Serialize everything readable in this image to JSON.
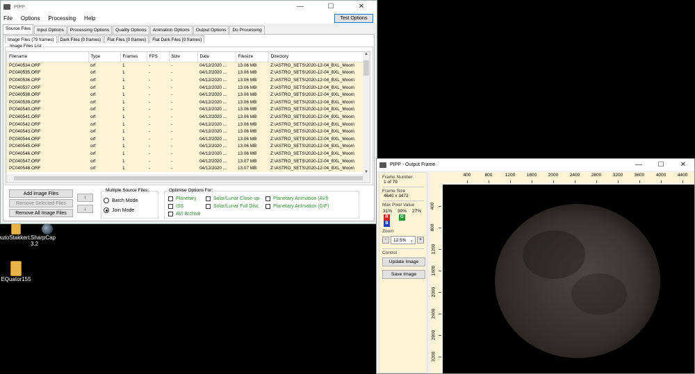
{
  "desktop": {
    "icons": [
      {
        "label": "AutoStakkert..."
      },
      {
        "label": "SharpCap 3.2"
      },
      {
        "label": "EQuator155"
      }
    ]
  },
  "main_window": {
    "title": "PIPP",
    "menu": [
      "File",
      "Options",
      "Processing",
      "Help"
    ],
    "test_options": "Test Options",
    "tabs": [
      "Source Files",
      "Input Options",
      "Processing Options",
      "Quality Options",
      "Animation Options",
      "Output Options",
      "Do Processing"
    ],
    "subtabs": [
      "Image Files (79 frames)",
      "Dark Files (0 frames)",
      "Flat Files (0 frames)",
      "Flat Dark Files (0 frames)"
    ],
    "list_group_label": "Image Files List",
    "columns": [
      "Filename",
      "Type",
      "Frames",
      "FPS",
      "Size",
      "Date",
      "Filesize",
      "Directory"
    ],
    "rows": [
      [
        "PC040534.ORF",
        "orf",
        "1",
        "-",
        "-",
        "04/12/2020 ...",
        "13.06 MB",
        "Z:\\ASTRO_SETS\\2020-12-04_BXL_Moon\\"
      ],
      [
        "PC040535.ORF",
        "orf",
        "1",
        "-",
        "-",
        "04/12/2020 ...",
        "13.06 MB",
        "Z:\\ASTRO_SETS\\2020-12-04_BXL_Moon\\"
      ],
      [
        "PC040536.ORF",
        "orf",
        "1",
        "-",
        "-",
        "04/12/2020 ...",
        "13.06 MB",
        "Z:\\ASTRO_SETS\\2020-12-04_BXL_Moon\\"
      ],
      [
        "PC040537.ORF",
        "orf",
        "1",
        "-",
        "-",
        "04/12/2020 ...",
        "13.06 MB",
        "Z:\\ASTRO_SETS\\2020-12-04_BXL_Moon\\"
      ],
      [
        "PC040538.ORF",
        "orf",
        "1",
        "-",
        "-",
        "04/12/2020 ...",
        "13.06 MB",
        "Z:\\ASTRO_SETS\\2020-12-04_BXL_Moon\\"
      ],
      [
        "PC040539.ORF",
        "orf",
        "1",
        "-",
        "-",
        "04/12/2020 ...",
        "13.06 MB",
        "Z:\\ASTRO_SETS\\2020-12-04_BXL_Moon\\"
      ],
      [
        "PC040540.ORF",
        "orf",
        "1",
        "-",
        "-",
        "04/12/2020 ...",
        "13.06 MB",
        "Z:\\ASTRO_SETS\\2020-12-04_BXL_Moon\\"
      ],
      [
        "PC040541.ORF",
        "orf",
        "1",
        "-",
        "-",
        "04/12/2020 ...",
        "13.06 MB",
        "Z:\\ASTRO_SETS\\2020-12-04_BXL_Moon\\"
      ],
      [
        "PC040542.ORF",
        "orf",
        "1",
        "-",
        "-",
        "04/12/2020 ...",
        "13.06 MB",
        "Z:\\ASTRO_SETS\\2020-12-04_BXL_Moon\\"
      ],
      [
        "PC040543.ORF",
        "orf",
        "1",
        "-",
        "-",
        "04/12/2020 ...",
        "13.06 MB",
        "Z:\\ASTRO_SETS\\2020-12-04_BXL_Moon\\"
      ],
      [
        "PC040544.ORF",
        "orf",
        "1",
        "-",
        "-",
        "04/12/2020 ...",
        "13.06 MB",
        "Z:\\ASTRO_SETS\\2020-12-04_BXL_Moon\\"
      ],
      [
        "PC040545.ORF",
        "orf",
        "1",
        "-",
        "-",
        "04/12/2020 ...",
        "13.06 MB",
        "Z:\\ASTRO_SETS\\2020-12-04_BXL_Moon\\"
      ],
      [
        "PC040546.ORF",
        "orf",
        "1",
        "-",
        "-",
        "04/12/2020 ...",
        "13.06 MB",
        "Z:\\ASTRO_SETS\\2020-12-04_BXL_Moon\\"
      ],
      [
        "PC040547.ORF",
        "orf",
        "1",
        "-",
        "-",
        "04/12/2020 ...",
        "13.07 MB",
        "Z:\\ASTRO_SETS\\2020-12-04_BXL_Moon\\"
      ],
      [
        "PC040548.ORF",
        "orf",
        "1",
        "-",
        "-",
        "04/12/2020 ...",
        "13.07 MB",
        "Z:\\ASTRO_SETS\\2020-12-04_BXL_Moon\\"
      ]
    ],
    "buttons": {
      "add": "Add Image Files",
      "remove_selected": "Remove Selected Files",
      "remove_all": "Remove All Image Files",
      "up": "↑",
      "down": "↓"
    },
    "multiple_source": {
      "label": "Multiple Source Files:",
      "batch": "Batch Mode",
      "join": "Join Mode",
      "selected": "join"
    },
    "optimise": {
      "label": "Optimise Options For:",
      "options": [
        "Planetary",
        "ISS",
        "AVI Archive",
        "Solar/Lunar Close-up",
        "Solar/Lunar Full Disc",
        "Planetary Animation (AVI)",
        "Planetary Animation (GIF)"
      ]
    }
  },
  "output_window": {
    "title": "PIPP - Output Frame",
    "frame_number_label": "Frame Number",
    "frame_number": "1 of 79",
    "frame_size_label": "Frame Size",
    "frame_size": "4640 x 3472",
    "max_pixel_label": "Max Pixel Value",
    "max_pixel": {
      "r": "31%",
      "g": "30%",
      "b": "27%"
    },
    "channel_letters": {
      "r": "R",
      "g": "G",
      "b": "B"
    },
    "channel_colors": {
      "r": "#d42020",
      "g": "#1f9a2e",
      "b": "#1d3fbf"
    },
    "zoom_label": "Zoom",
    "zoom_value": "12.5%",
    "zoom_minus": "-",
    "zoom_plus": "+",
    "control_label": "Control",
    "update_image": "Update Image",
    "save_image": "Save Image",
    "ruler_top": [
      "400",
      "800",
      "1200",
      "1600",
      "2000",
      "2400",
      "2800",
      "3200",
      "3600",
      "4000",
      "4400"
    ],
    "ruler_left": [
      "400",
      "800",
      "1200",
      "1600",
      "2000",
      "2400",
      "2800",
      "3200"
    ]
  }
}
